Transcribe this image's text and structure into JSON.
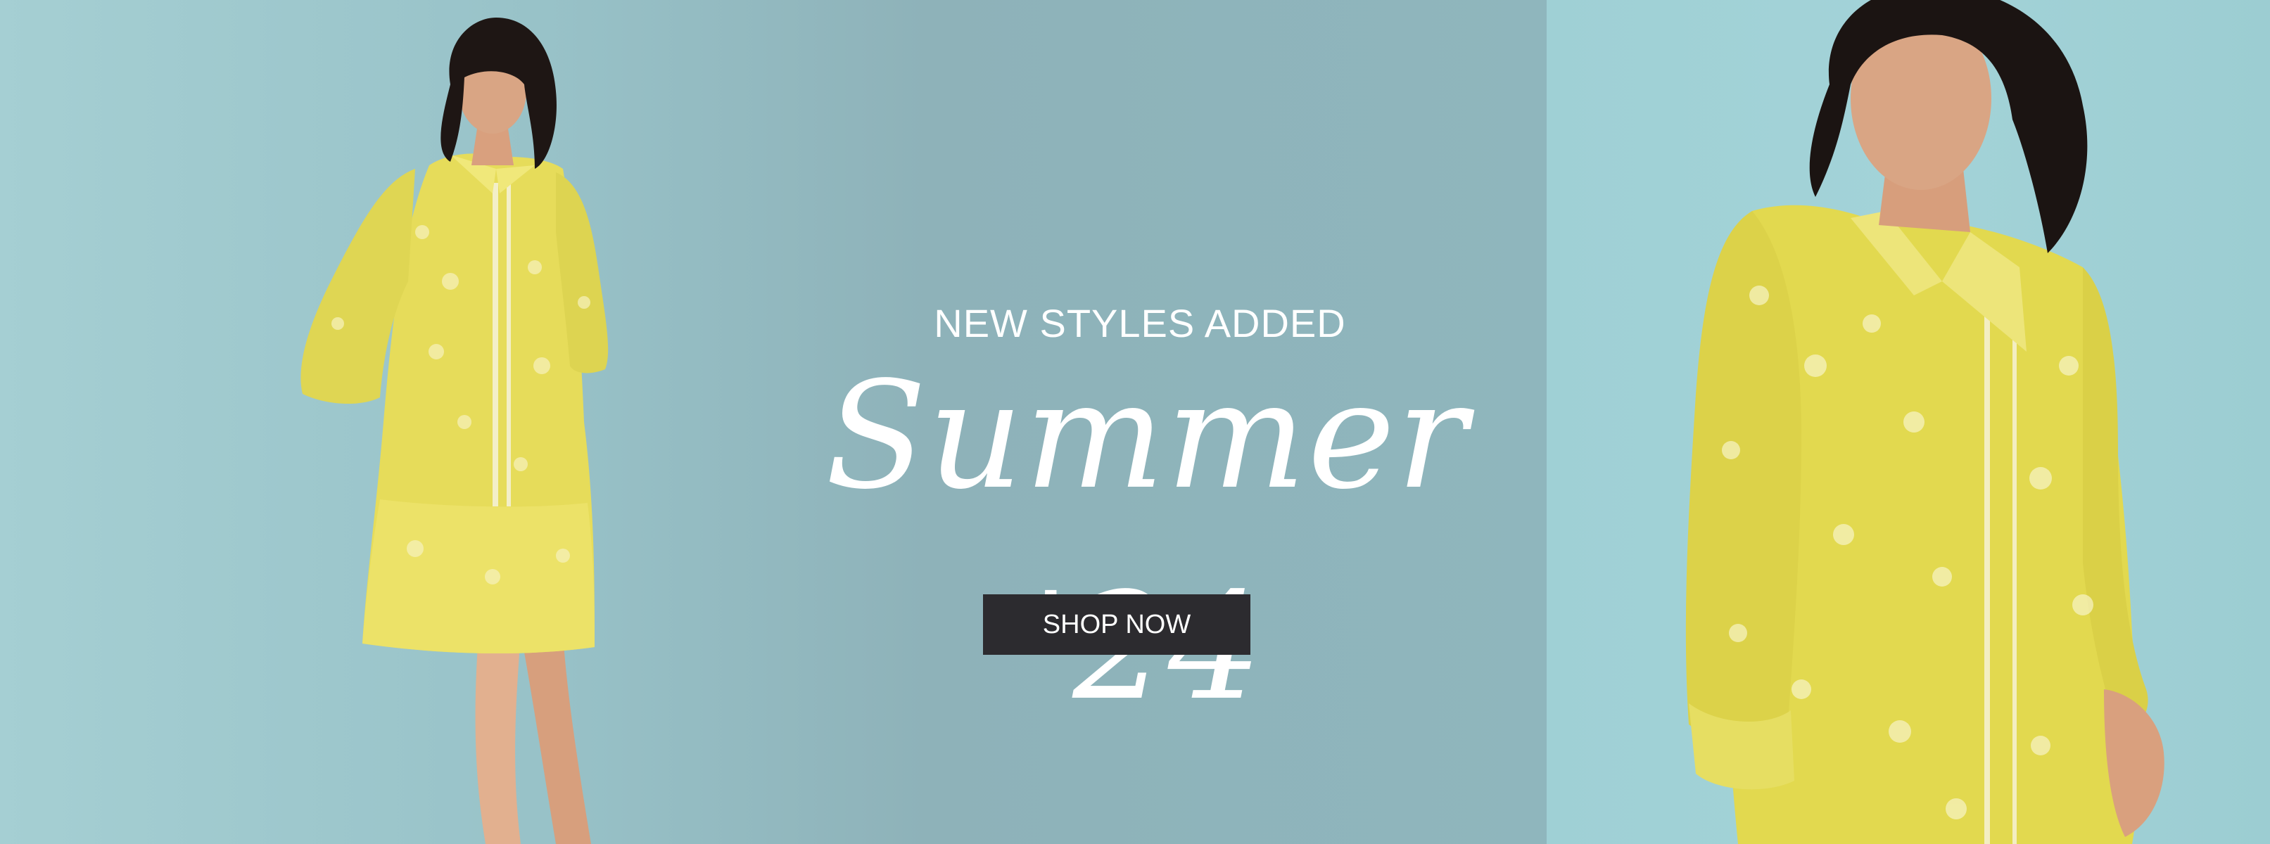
{
  "hero": {
    "kicker": "NEW STYLES ADDED",
    "title": "Summer '24",
    "cta_label": "SHOP NOW"
  },
  "colors": {
    "background_left": "#95bec4",
    "background_right": "#a1d2d7",
    "dress_yellow": "#e4dc58",
    "cta_background": "#2c2b2f",
    "text": "#ffffff"
  }
}
